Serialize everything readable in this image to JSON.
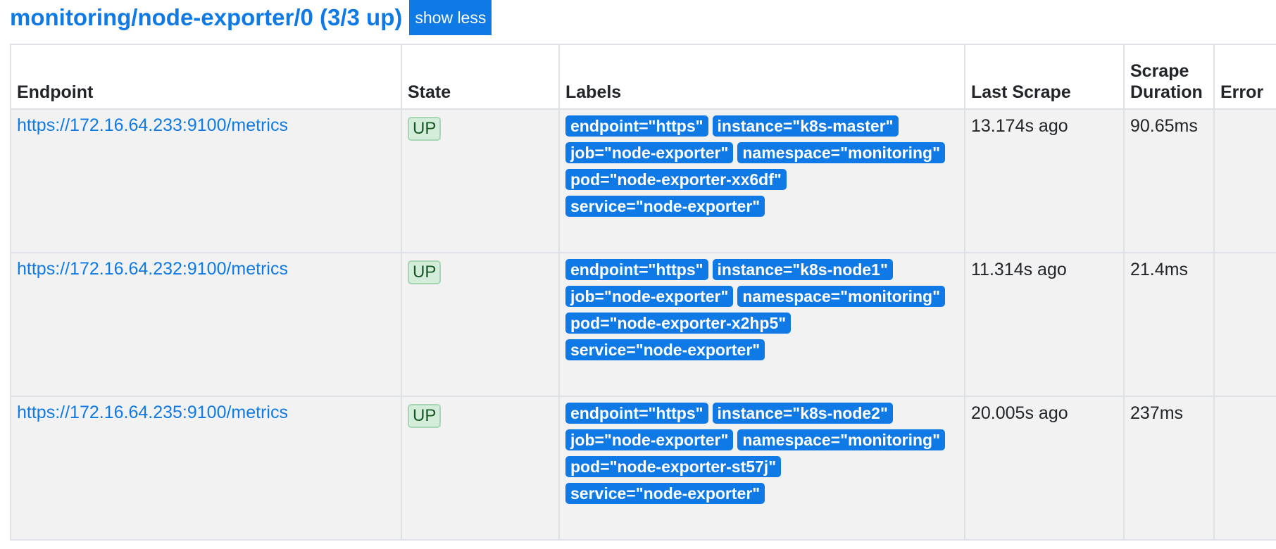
{
  "job": {
    "title": "monitoring/node-exporter/0 (3/3 up)",
    "toggle_label": "show less"
  },
  "table": {
    "headers": {
      "endpoint": "Endpoint",
      "state": "State",
      "labels": "Labels",
      "last_scrape": "Last Scrape",
      "scrape_duration": "Scrape Duration",
      "error": "Error"
    },
    "rows": [
      {
        "endpoint": "https://172.16.64.233:9100/metrics",
        "state": "UP",
        "labels": [
          "endpoint=\"https\"",
          "instance=\"k8s-master\"",
          "job=\"node-exporter\"",
          "namespace=\"monitoring\"",
          "pod=\"node-exporter-xx6df\"",
          "service=\"node-exporter\""
        ],
        "last_scrape": "13.174s ago",
        "scrape_duration": "90.65ms",
        "error": ""
      },
      {
        "endpoint": "https://172.16.64.232:9100/metrics",
        "state": "UP",
        "labels": [
          "endpoint=\"https\"",
          "instance=\"k8s-node1\"",
          "job=\"node-exporter\"",
          "namespace=\"monitoring\"",
          "pod=\"node-exporter-x2hp5\"",
          "service=\"node-exporter\""
        ],
        "last_scrape": "11.314s ago",
        "scrape_duration": "21.4ms",
        "error": ""
      },
      {
        "endpoint": "https://172.16.64.235:9100/metrics",
        "state": "UP",
        "labels": [
          "endpoint=\"https\"",
          "instance=\"k8s-node2\"",
          "job=\"node-exporter\"",
          "namespace=\"monitoring\"",
          "pod=\"node-exporter-st57j\"",
          "service=\"node-exporter\""
        ],
        "last_scrape": "20.005s ago",
        "scrape_duration": "237ms",
        "error": ""
      }
    ]
  },
  "colors": {
    "accent": "#0f7ae5",
    "state_up_bg": "#d4edda",
    "state_up_text": "#155724",
    "row_bg": "#f2f2f2"
  }
}
